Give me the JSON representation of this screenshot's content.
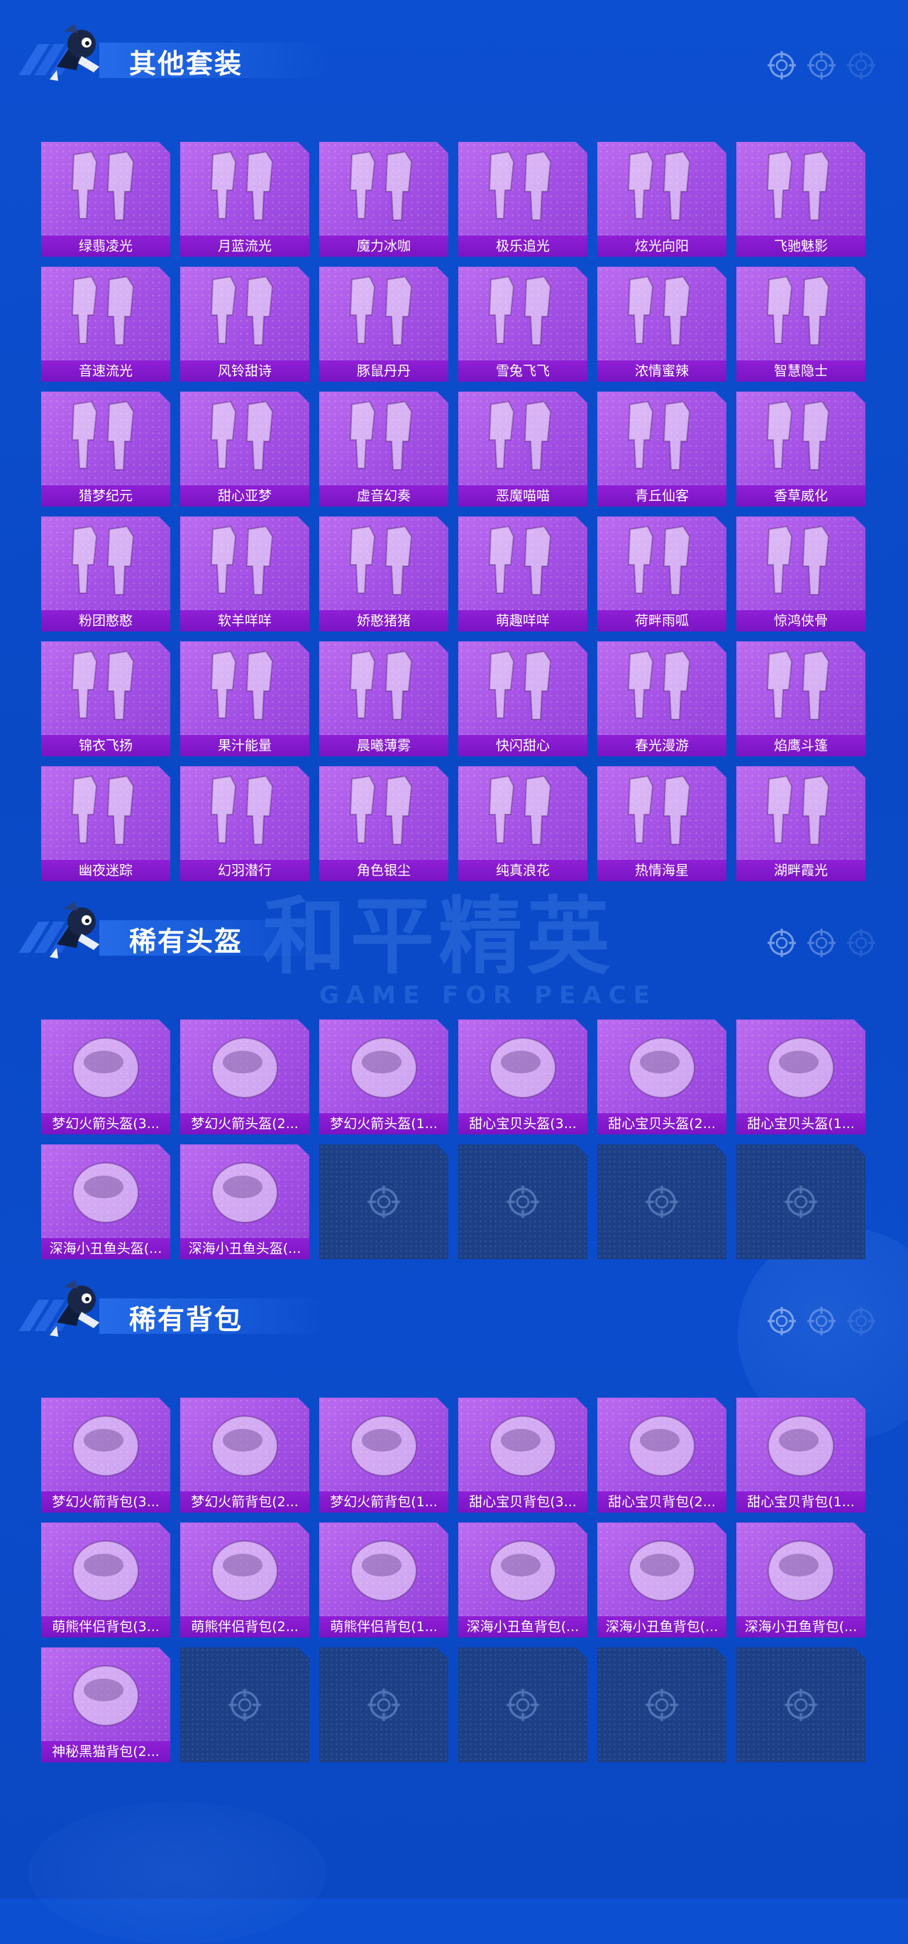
{
  "sections": [
    {
      "title": "其他套装",
      "items": [
        "绿翡凌光",
        "月蓝流光",
        "魔力冰咖",
        "极乐追光",
        "炫光向阳",
        "飞驰魅影",
        "音速流光",
        "风铃甜诗",
        "豚鼠丹丹",
        "雪兔飞飞",
        "浓情蜜辣",
        "智慧隐士",
        "猎梦纪元",
        "甜心亚梦",
        "虚音幻奏",
        "恶魔喵喵",
        "青丘仙客",
        "香草威化",
        "粉团憨憨",
        "软羊咩咩",
        "娇憨猪猪",
        "萌趣咩咩",
        "荷畔雨呱",
        "惊鸿侠骨",
        "锦衣飞扬",
        "果汁能量",
        "晨曦薄雾",
        "快闪甜心",
        "春光漫游",
        "焰鹰斗篷",
        "幽夜迷踪",
        "幻羽潜行",
        "角色银尘",
        "纯真浪花",
        "热情海星",
        "湖畔霞光"
      ],
      "empty_slots": 0
    },
    {
      "title": "稀有头盔",
      "items": [
        "梦幻火箭头盔(3...",
        "梦幻火箭头盔(2...",
        "梦幻火箭头盔(1...",
        "甜心宝贝头盔(3...",
        "甜心宝贝头盔(2...",
        "甜心宝贝头盔(1...",
        "深海小丑鱼头盔(...",
        "深海小丑鱼头盔(..."
      ],
      "empty_slots": 4
    },
    {
      "title": "稀有背包",
      "items": [
        "梦幻火箭背包(3...",
        "梦幻火箭背包(2...",
        "梦幻火箭背包(1...",
        "甜心宝贝背包(3...",
        "甜心宝贝背包(2...",
        "甜心宝贝背包(1...",
        "萌熊伴侣背包(3...",
        "萌熊伴侣背包(2...",
        "萌熊伴侣背包(1...",
        "深海小丑鱼背包(...",
        "深海小丑鱼背包(...",
        "深海小丑鱼背包(...",
        "神秘黑猫背包(2..."
      ],
      "empty_slots": 5
    }
  ],
  "watermark": {
    "main": "和平精英",
    "sub": "GAME FOR PEACE"
  },
  "icons": {
    "section_deco": "crosshair-icon",
    "empty_slot": "crosshair-icon",
    "mascot": "mascot-icon"
  },
  "colors": {
    "background": "#0b4ccc",
    "card": "#a24fe4",
    "label_bar": "#8419cd",
    "empty_card": "#1d3f86"
  }
}
